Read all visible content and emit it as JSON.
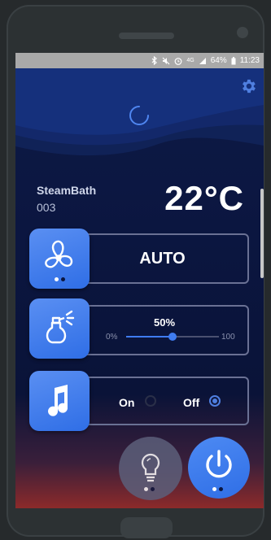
{
  "status_bar": {
    "battery_percent": "64%",
    "network": "4G",
    "time": "11:23",
    "icons": [
      "bluetooth-icon",
      "mute-icon",
      "alarm-icon",
      "signal-icon",
      "battery-icon"
    ]
  },
  "header": {
    "settings_icon": "gear-icon",
    "loading_icon": "spinner-icon"
  },
  "device": {
    "name": "SteamBath",
    "id": "003",
    "temperature": "22°C"
  },
  "fan": {
    "icon": "fan-icon",
    "mode": "AUTO",
    "page_dots": {
      "active": 0,
      "count": 2
    }
  },
  "aroma": {
    "icon": "aroma-dispenser-icon",
    "value_label": "50%",
    "value": 50,
    "min_label": "0%",
    "max_label": "100"
  },
  "music": {
    "icon": "music-note-icon",
    "on_label": "On",
    "off_label": "Off",
    "selected": "Off"
  },
  "light_button": {
    "icon": "light-bulb-icon",
    "page_dots": {
      "active": 0,
      "count": 2
    }
  },
  "power_button": {
    "icon": "power-icon",
    "page_dots": {
      "active": 0,
      "count": 2
    }
  },
  "colors": {
    "accent": "#3f7cf0",
    "tile_blue": "#2f6ee6",
    "background_navy": "#0b1640",
    "bottom_glow": "#8c2a2a"
  }
}
